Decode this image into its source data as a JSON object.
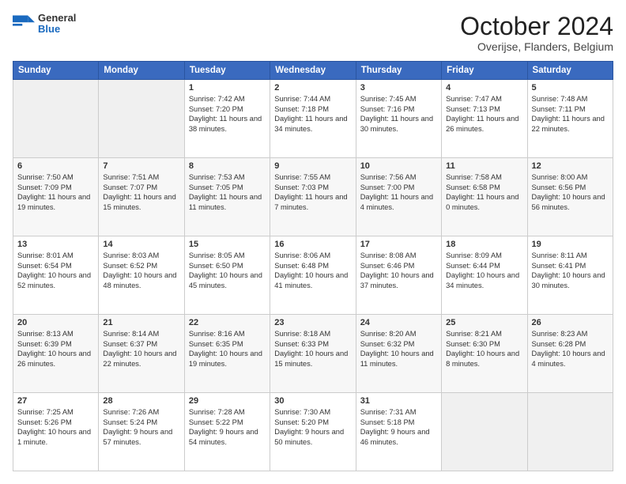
{
  "header": {
    "logo_general": "General",
    "logo_blue": "Blue",
    "title": "October 2024",
    "subtitle": "Overijse, Flanders, Belgium"
  },
  "days_of_week": [
    "Sunday",
    "Monday",
    "Tuesday",
    "Wednesday",
    "Thursday",
    "Friday",
    "Saturday"
  ],
  "weeks": [
    [
      {
        "day": "",
        "content": ""
      },
      {
        "day": "",
        "content": ""
      },
      {
        "day": "1",
        "content": "Sunrise: 7:42 AM\nSunset: 7:20 PM\nDaylight: 11 hours and 38 minutes."
      },
      {
        "day": "2",
        "content": "Sunrise: 7:44 AM\nSunset: 7:18 PM\nDaylight: 11 hours and 34 minutes."
      },
      {
        "day": "3",
        "content": "Sunrise: 7:45 AM\nSunset: 7:16 PM\nDaylight: 11 hours and 30 minutes."
      },
      {
        "day": "4",
        "content": "Sunrise: 7:47 AM\nSunset: 7:13 PM\nDaylight: 11 hours and 26 minutes."
      },
      {
        "day": "5",
        "content": "Sunrise: 7:48 AM\nSunset: 7:11 PM\nDaylight: 11 hours and 22 minutes."
      }
    ],
    [
      {
        "day": "6",
        "content": "Sunrise: 7:50 AM\nSunset: 7:09 PM\nDaylight: 11 hours and 19 minutes."
      },
      {
        "day": "7",
        "content": "Sunrise: 7:51 AM\nSunset: 7:07 PM\nDaylight: 11 hours and 15 minutes."
      },
      {
        "day": "8",
        "content": "Sunrise: 7:53 AM\nSunset: 7:05 PM\nDaylight: 11 hours and 11 minutes."
      },
      {
        "day": "9",
        "content": "Sunrise: 7:55 AM\nSunset: 7:03 PM\nDaylight: 11 hours and 7 minutes."
      },
      {
        "day": "10",
        "content": "Sunrise: 7:56 AM\nSunset: 7:00 PM\nDaylight: 11 hours and 4 minutes."
      },
      {
        "day": "11",
        "content": "Sunrise: 7:58 AM\nSunset: 6:58 PM\nDaylight: 11 hours and 0 minutes."
      },
      {
        "day": "12",
        "content": "Sunrise: 8:00 AM\nSunset: 6:56 PM\nDaylight: 10 hours and 56 minutes."
      }
    ],
    [
      {
        "day": "13",
        "content": "Sunrise: 8:01 AM\nSunset: 6:54 PM\nDaylight: 10 hours and 52 minutes."
      },
      {
        "day": "14",
        "content": "Sunrise: 8:03 AM\nSunset: 6:52 PM\nDaylight: 10 hours and 48 minutes."
      },
      {
        "day": "15",
        "content": "Sunrise: 8:05 AM\nSunset: 6:50 PM\nDaylight: 10 hours and 45 minutes."
      },
      {
        "day": "16",
        "content": "Sunrise: 8:06 AM\nSunset: 6:48 PM\nDaylight: 10 hours and 41 minutes."
      },
      {
        "day": "17",
        "content": "Sunrise: 8:08 AM\nSunset: 6:46 PM\nDaylight: 10 hours and 37 minutes."
      },
      {
        "day": "18",
        "content": "Sunrise: 8:09 AM\nSunset: 6:44 PM\nDaylight: 10 hours and 34 minutes."
      },
      {
        "day": "19",
        "content": "Sunrise: 8:11 AM\nSunset: 6:41 PM\nDaylight: 10 hours and 30 minutes."
      }
    ],
    [
      {
        "day": "20",
        "content": "Sunrise: 8:13 AM\nSunset: 6:39 PM\nDaylight: 10 hours and 26 minutes."
      },
      {
        "day": "21",
        "content": "Sunrise: 8:14 AM\nSunset: 6:37 PM\nDaylight: 10 hours and 22 minutes."
      },
      {
        "day": "22",
        "content": "Sunrise: 8:16 AM\nSunset: 6:35 PM\nDaylight: 10 hours and 19 minutes."
      },
      {
        "day": "23",
        "content": "Sunrise: 8:18 AM\nSunset: 6:33 PM\nDaylight: 10 hours and 15 minutes."
      },
      {
        "day": "24",
        "content": "Sunrise: 8:20 AM\nSunset: 6:32 PM\nDaylight: 10 hours and 11 minutes."
      },
      {
        "day": "25",
        "content": "Sunrise: 8:21 AM\nSunset: 6:30 PM\nDaylight: 10 hours and 8 minutes."
      },
      {
        "day": "26",
        "content": "Sunrise: 8:23 AM\nSunset: 6:28 PM\nDaylight: 10 hours and 4 minutes."
      }
    ],
    [
      {
        "day": "27",
        "content": "Sunrise: 7:25 AM\nSunset: 5:26 PM\nDaylight: 10 hours and 1 minute."
      },
      {
        "day": "28",
        "content": "Sunrise: 7:26 AM\nSunset: 5:24 PM\nDaylight: 9 hours and 57 minutes."
      },
      {
        "day": "29",
        "content": "Sunrise: 7:28 AM\nSunset: 5:22 PM\nDaylight: 9 hours and 54 minutes."
      },
      {
        "day": "30",
        "content": "Sunrise: 7:30 AM\nSunset: 5:20 PM\nDaylight: 9 hours and 50 minutes."
      },
      {
        "day": "31",
        "content": "Sunrise: 7:31 AM\nSunset: 5:18 PM\nDaylight: 9 hours and 46 minutes."
      },
      {
        "day": "",
        "content": ""
      },
      {
        "day": "",
        "content": ""
      }
    ]
  ]
}
